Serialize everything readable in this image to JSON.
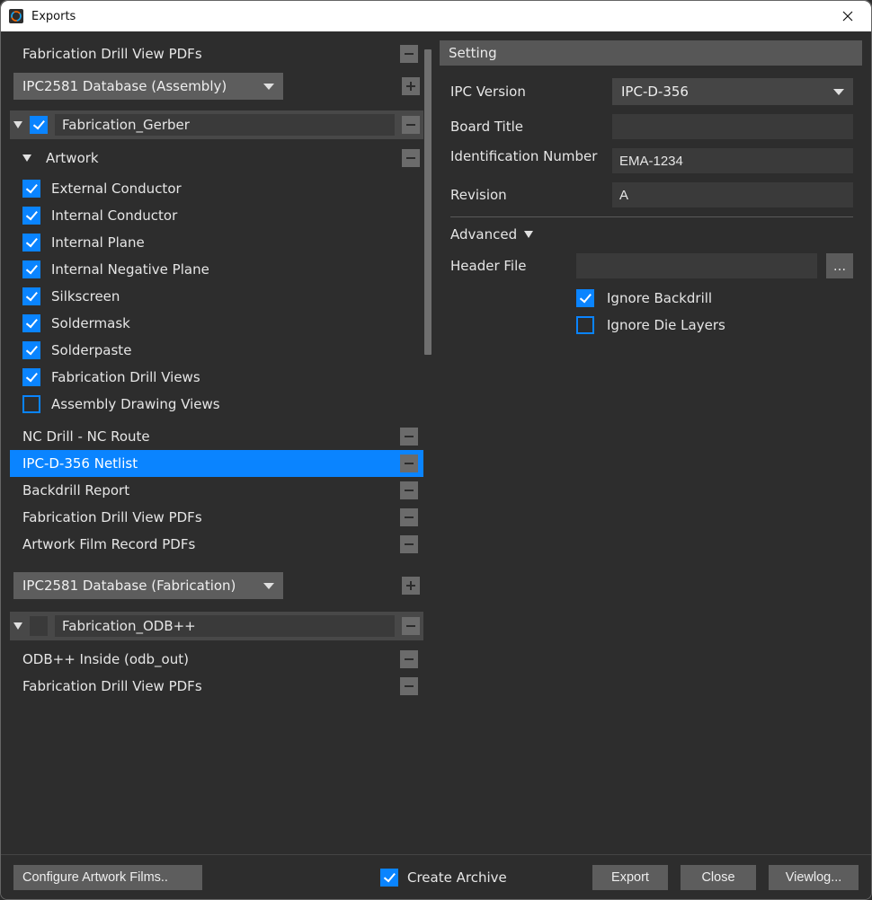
{
  "window": {
    "title": "Exports"
  },
  "left": {
    "top_section": {
      "label": "Fabrication Drill View PDFs"
    },
    "top_dropdown": "IPC2581 Database (Assembly)",
    "group_gerber": {
      "name": "Fabrication_Gerber",
      "checked": true,
      "artwork_label": "Artwork",
      "artwork_items": [
        {
          "label": "External Conductor",
          "checked": true
        },
        {
          "label": "Internal Conductor",
          "checked": true
        },
        {
          "label": "Internal Plane",
          "checked": true
        },
        {
          "label": "Internal Negative Plane",
          "checked": true
        },
        {
          "label": "Silkscreen",
          "checked": true
        },
        {
          "label": "Soldermask",
          "checked": true
        },
        {
          "label": "Solderpaste",
          "checked": true
        },
        {
          "label": "Fabrication Drill Views",
          "checked": true
        },
        {
          "label": "Assembly Drawing Views",
          "checked": false
        }
      ],
      "sub_sections": [
        {
          "label": "NC Drill - NC Route",
          "selected": false
        },
        {
          "label": "IPC-D-356 Netlist",
          "selected": true
        },
        {
          "label": "Backdrill Report",
          "selected": false
        },
        {
          "label": "Fabrication Drill View PDFs",
          "selected": false
        },
        {
          "label": "Artwork Film Record PDFs",
          "selected": false
        }
      ],
      "bottom_dropdown": "IPC2581 Database (Fabrication)"
    },
    "group_odb": {
      "name": "Fabrication_ODB++",
      "checked": false,
      "sections": [
        {
          "label": "ODB++ Inside (odb_out)"
        },
        {
          "label": "Fabrication Drill View PDFs"
        }
      ]
    }
  },
  "right": {
    "header": "Setting",
    "ipc_version_label": "IPC Version",
    "ipc_version_value": "IPC-D-356",
    "board_title_label": "Board Title",
    "board_title_value": "",
    "ident_label": "Identification Number",
    "ident_value": "EMA-1234",
    "revision_label": "Revision",
    "revision_value": "A",
    "advanced_label": "Advanced",
    "header_file_label": "Header File",
    "header_file_value": "",
    "browse_label": "...",
    "ignore_backdrill": {
      "label": "Ignore Backdrill",
      "checked": true
    },
    "ignore_die": {
      "label": "Ignore Die Layers",
      "checked": false
    }
  },
  "footer": {
    "configure": "Configure Artwork Films..",
    "create_archive": {
      "label": "Create Archive",
      "checked": true
    },
    "export": "Export",
    "close": "Close",
    "viewlog": "Viewlog..."
  }
}
